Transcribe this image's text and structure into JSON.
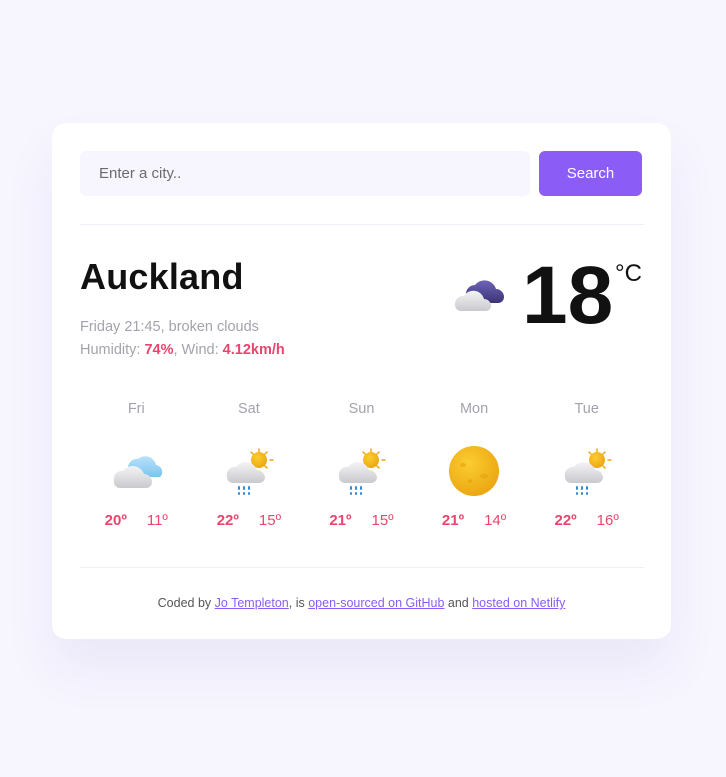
{
  "search": {
    "placeholder": "Enter a city..",
    "button_label": "Search"
  },
  "current": {
    "city": "Auckland",
    "datetime_desc": "Friday 21:45, broken clouds",
    "humidity_label": "Humidity: ",
    "humidity_value": "74%",
    "wind_label": ", Wind: ",
    "wind_value": "4.12km/h",
    "temperature": "18",
    "unit": "°C",
    "icon": "broken-clouds-night-icon"
  },
  "forecast": [
    {
      "day": "Fri",
      "icon": "cloudy-icon",
      "max": "20º",
      "min": "11º"
    },
    {
      "day": "Sat",
      "icon": "rain-sun-icon",
      "max": "22º",
      "min": "15º"
    },
    {
      "day": "Sun",
      "icon": "rain-sun-icon",
      "max": "21º",
      "min": "15º"
    },
    {
      "day": "Mon",
      "icon": "sun-icon",
      "max": "21º",
      "min": "14º"
    },
    {
      "day": "Tue",
      "icon": "rain-sun-icon",
      "max": "22º",
      "min": "16º"
    }
  ],
  "footer": {
    "text1": "Coded by ",
    "link1": "Jo Templeton",
    "text2": ", is ",
    "link2": "open-sourced on GitHub",
    "text3": " and ",
    "link3": "hosted on Netlify"
  },
  "colors": {
    "accent": "#8b5cf6",
    "highlight": "#e8466c",
    "background": "#f7f6fe"
  }
}
